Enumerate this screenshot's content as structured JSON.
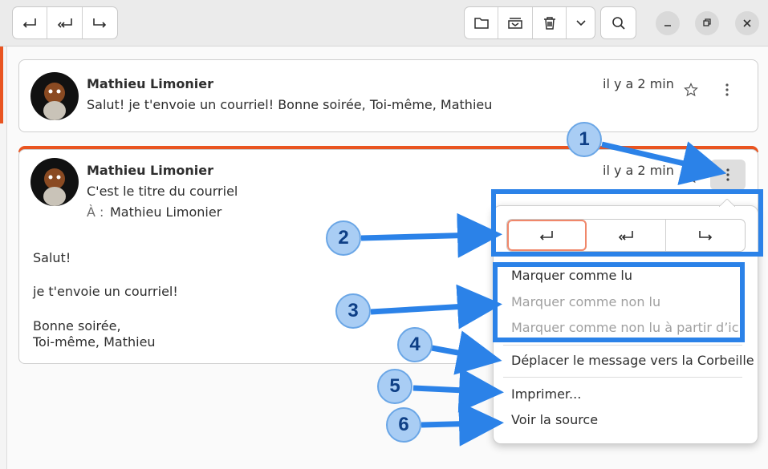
{
  "toolbar": {
    "reply_icon": "reply-icon",
    "reply_all_icon": "reply-all-icon",
    "forward_icon": "forward-icon",
    "move_icon": "folder-icon",
    "archive_icon": "archive-icon",
    "trash_icon": "trash-icon",
    "more_icon": "chevron-down-icon",
    "search_icon": "search-icon"
  },
  "window": {
    "minimize_icon": "minimize-icon",
    "restore_icon": "restore-icon",
    "close_icon": "close-icon"
  },
  "colors": {
    "accent": "#e95420",
    "callout_fill": "#a9cdf4",
    "callout_text": "#0e3f86",
    "highlight": "#2b82e8"
  },
  "messages": [
    {
      "sender": "Mathieu Limonier",
      "time": "il y a 2 min",
      "preview": "Salut! je t'envoie un courriel! Bonne soirée, Toi-même, Mathieu"
    },
    {
      "sender": "Mathieu Limonier",
      "time": "il y a 2 min",
      "subject": "C'est le titre du courriel",
      "to_label": "À :",
      "to_name": "Mathieu Limonier",
      "body": [
        "Salut!",
        "je t'envoie un courriel!",
        "Bonne soirée,",
        "Toi-même, Mathieu"
      ]
    }
  ],
  "menu": {
    "mark_read": "Marquer comme lu",
    "mark_unread": "Marquer comme non lu",
    "mark_unread_from_here": "Marquer comme non lu à partir d’ici",
    "move_to_trash": "Déplacer le message vers la Corbeille",
    "print": "Imprimer...",
    "view_source": "Voir la source"
  },
  "callouts": [
    "1",
    "2",
    "3",
    "4",
    "5",
    "6"
  ]
}
